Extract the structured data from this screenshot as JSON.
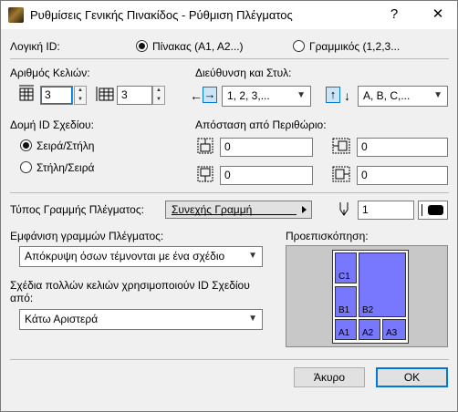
{
  "titlebar": {
    "title": "Ρυθμίσεις Γενικής Πινακίδος - Ρύθμιση Πλέγματος",
    "help": "?",
    "close": "✕"
  },
  "logical_id": {
    "label": "Λογική ID:",
    "option_table": "Πίνακας (A1, A2...)",
    "option_linear": "Γραμμικός (1,2,3...",
    "selected": "table"
  },
  "cell_count": {
    "label": "Αριθμός Κελιών:",
    "rows_value": "3",
    "cols_value": "3"
  },
  "direction": {
    "label": "Διεύθυνση και Στυλ:",
    "arrow_left": "←",
    "arrow_right": "→",
    "horizontal_value": "1, 2, 3,...",
    "arrow_up": "↑",
    "arrow_down": "↓",
    "vertical_value": "A, B, C,..."
  },
  "structure": {
    "label": "Δομή ID Σχεδίου:",
    "option_row_col": "Σειρά/Στήλη",
    "option_col_row": "Στήλη/Σειρά",
    "selected": "row_col"
  },
  "margins": {
    "label": "Απόσταση από Περιθώριο:",
    "top": "0",
    "left": "0",
    "bottom": "0",
    "right": "0"
  },
  "line_type": {
    "label": "Τύπος Γραμμής Πλέγματος:",
    "value": "Συνεχής Γραμμή",
    "pen_value": "1"
  },
  "show_lines": {
    "label": "Εμφάνιση γραμμών Πλέγματος:",
    "value": "Απόκρυψη όσων τέμνονται με ένα σχέδιο"
  },
  "multi_cell": {
    "label_line1": "Σχέδια πολλών κελιών χρησιμοποιούν ID Σχεδίου",
    "label_line2": "από:",
    "value": "Κάτω Αριστερά"
  },
  "preview": {
    "label": "Προεπισκόπηση:",
    "cells": [
      "C1",
      "B1",
      "B2",
      "A1",
      "A2",
      "A3"
    ],
    "cell_color": "#7878ff"
  },
  "buttons": {
    "cancel": "Άκυρο",
    "ok": "OK"
  }
}
